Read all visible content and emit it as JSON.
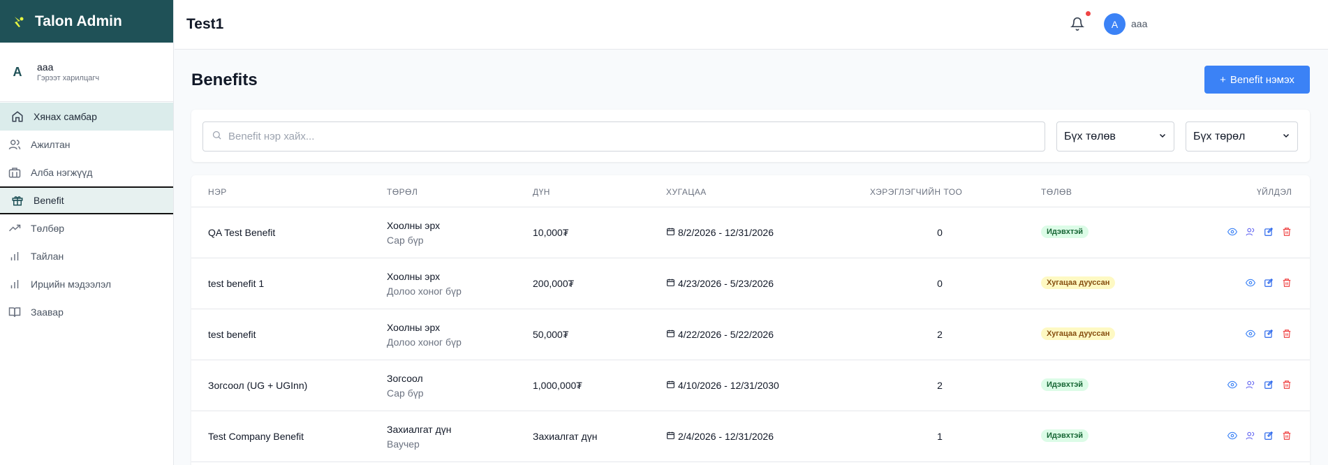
{
  "sidebar": {
    "brand": "Talon Admin",
    "user": {
      "initial": "A",
      "name": "aaa",
      "role": "Гэрээт харилцагч"
    },
    "items": [
      {
        "label": "Хянах самбар",
        "icon": "home-icon"
      },
      {
        "label": "Ажилтан",
        "icon": "users-icon"
      },
      {
        "label": "Алба нэгжүүд",
        "icon": "building-icon"
      },
      {
        "label": "Benefit",
        "icon": "gift-icon"
      },
      {
        "label": "Төлбөр",
        "icon": "trending-up-icon"
      },
      {
        "label": "Тайлан",
        "icon": "bar-chart-icon"
      },
      {
        "label": "Ирцийн мэдээлэл",
        "icon": "bar-chart-icon"
      },
      {
        "label": "Заавар",
        "icon": "book-icon"
      }
    ]
  },
  "topbar": {
    "title": "Test1",
    "avatar_initial": "A",
    "user_name": "aaa"
  },
  "main": {
    "title": "Benefits",
    "add_button": "Benefit нэмэх",
    "search_placeholder": "Benefit нэр хайх...",
    "status_filter": "Бүх төлөв",
    "type_filter": "Бүх төрөл"
  },
  "table": {
    "headers": {
      "name": "НЭР",
      "type": "ТӨРӨЛ",
      "amount": "ДҮН",
      "duration": "ХУГАЦАА",
      "users": "ХЭРЭГЛЭГЧИЙН ТОО",
      "status": "ТӨЛӨВ",
      "actions": "ҮЙЛДЭЛ"
    },
    "rows": [
      {
        "name": "QA Test Benefit",
        "type": "Хоолны эрх",
        "freq": "Сар бүр",
        "amount": "10,000₮",
        "duration": "8/2/2026 - 12/31/2026",
        "users": "0",
        "status": "Идэвхтэй",
        "status_kind": "active",
        "has_users_action": true
      },
      {
        "name": "test benefit 1",
        "type": "Хоолны эрх",
        "freq": "Долоо хоног бүр",
        "amount": "200,000₮",
        "duration": "4/23/2026 - 5/23/2026",
        "users": "0",
        "status": "Хугацаа дууссан",
        "status_kind": "expired",
        "has_users_action": false
      },
      {
        "name": "test benefit",
        "type": "Хоолны эрх",
        "freq": "Долоо хоног бүр",
        "amount": "50,000₮",
        "duration": "4/22/2026 - 5/22/2026",
        "users": "2",
        "status": "Хугацаа дууссан",
        "status_kind": "expired",
        "has_users_action": false
      },
      {
        "name": "Зогсоол (UG + UGInn)",
        "type": "Зогсоол",
        "freq": "Сар бүр",
        "amount": "1,000,000₮",
        "duration": "4/10/2026 - 12/31/2030",
        "users": "2",
        "status": "Идэвхтэй",
        "status_kind": "active",
        "has_users_action": true
      },
      {
        "name": "Test Company Benefit",
        "type": "Захиалгат дүн",
        "freq": "Ваучер",
        "amount": "Захиалгат дүн",
        "duration": "2/4/2026 - 12/31/2026",
        "users": "1",
        "status": "Идэвхтэй",
        "status_kind": "active",
        "has_users_action": true
      }
    ]
  },
  "colors": {
    "brand_bg": "#1f5157",
    "logo": "#e5f542",
    "primary": "#3b82f6",
    "active_badge_bg": "#dcfce7",
    "expired_badge_bg": "#fef9c3",
    "delete": "#ef4444"
  }
}
